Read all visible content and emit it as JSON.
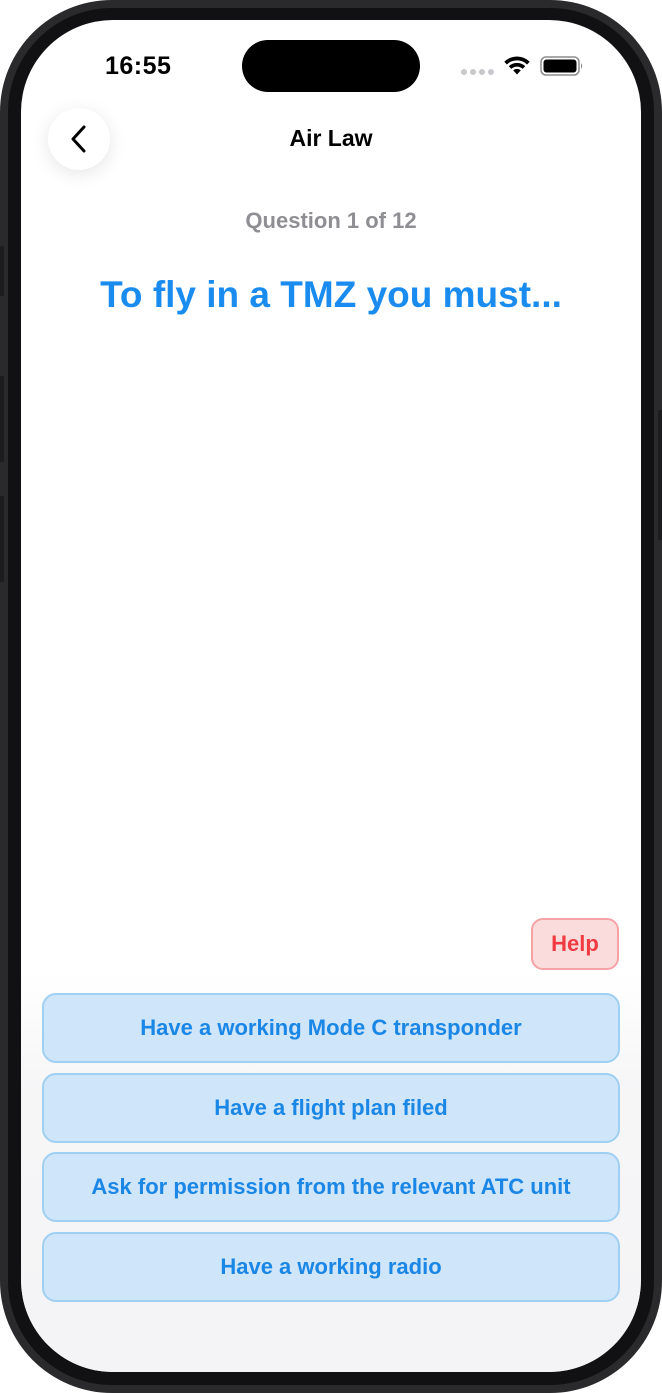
{
  "status_bar": {
    "time": "16:55",
    "icons": [
      "cellular-dots-icon",
      "wifi-icon",
      "battery-icon"
    ]
  },
  "nav": {
    "title": "Air Law",
    "back_icon": "chevron-left-icon"
  },
  "question": {
    "counter": "Question 1 of 12",
    "text": "To fly in a TMZ you must..."
  },
  "help": {
    "label": "Help"
  },
  "answers": [
    {
      "label": "Have a working Mode C transponder"
    },
    {
      "label": "Have a flight plan filed"
    },
    {
      "label": "Ask for permission from the relevant ATC unit"
    },
    {
      "label": "Have a working radio"
    }
  ],
  "colors": {
    "accent_blue": "#1A8CF0",
    "answer_bg": "#CFE5F9",
    "answer_border": "#9FD0F4",
    "help_red": "#EF3B41",
    "help_bg": "#FBDCDD",
    "muted_gray": "#8E8E93"
  }
}
